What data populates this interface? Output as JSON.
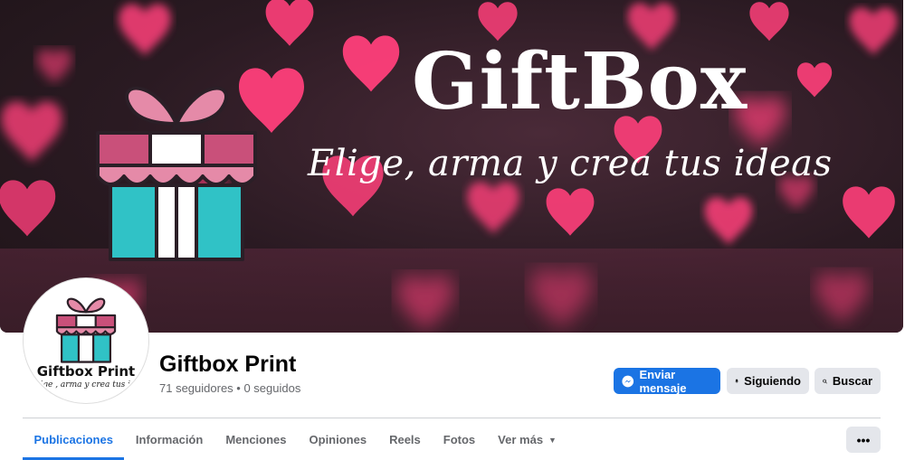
{
  "cover": {
    "title": "GiftBox",
    "subtitle": "Elige, arma y crea tus ideas"
  },
  "avatar": {
    "name": "Giftbox Print",
    "subtitle": "Elige , arma y crea tus ide"
  },
  "page": {
    "name": "Giftbox Print",
    "stats": "71 seguidores • 0 seguidos"
  },
  "actions": {
    "message": {
      "label": "Enviar mensaje",
      "icon": "messenger-icon"
    },
    "following": {
      "label": "Siguiendo",
      "icon": "bell-icon"
    },
    "search": {
      "label": "Buscar",
      "icon": "search-icon"
    }
  },
  "tabs": [
    {
      "label": "Publicaciones",
      "active": true
    },
    {
      "label": "Información"
    },
    {
      "label": "Menciones"
    },
    {
      "label": "Opiniones"
    },
    {
      "label": "Reels"
    },
    {
      "label": "Fotos"
    },
    {
      "label": "Ver más",
      "icon": "caret-down-icon"
    }
  ],
  "more_button": {
    "label": "•••",
    "icon": "ellipsis-icon"
  },
  "colors": {
    "accent": "#1b74e4",
    "gift_pink": "#d9567e",
    "gift_teal": "#33c1c7",
    "heart": "#ff3f7a"
  }
}
